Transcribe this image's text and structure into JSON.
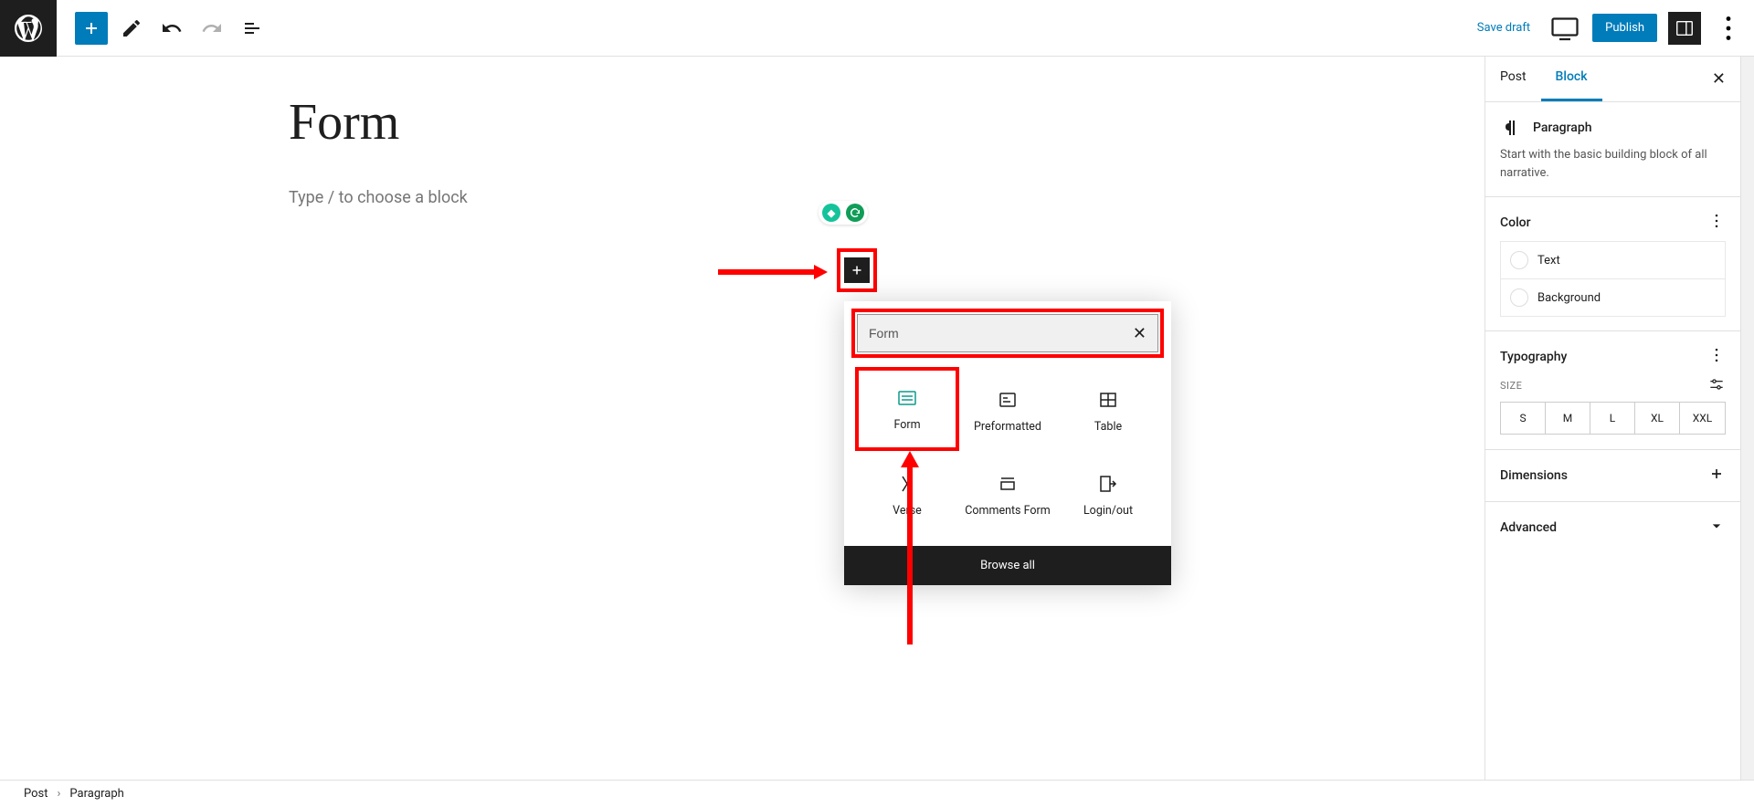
{
  "header": {
    "save_draft": "Save draft",
    "publish": "Publish"
  },
  "editor": {
    "title": "Form",
    "placeholder": "Type / to choose a block"
  },
  "popup": {
    "search_value": "Form",
    "items": [
      "Form",
      "Preformatted",
      "Table",
      "Verse",
      "Comments Form",
      "Login/out"
    ],
    "browse_all": "Browse all"
  },
  "sidebar": {
    "tabs": {
      "post": "Post",
      "block": "Block"
    },
    "block_name": "Paragraph",
    "block_desc": "Start with the basic building block of all narrative.",
    "color": {
      "title": "Color",
      "text": "Text",
      "background": "Background"
    },
    "typography": {
      "title": "Typography",
      "size_label": "SIZE",
      "sizes": [
        "S",
        "M",
        "L",
        "XL",
        "XXL"
      ]
    },
    "dimensions": "Dimensions",
    "advanced": "Advanced"
  },
  "footer": {
    "crumb1": "Post",
    "crumb2": "Paragraph"
  }
}
